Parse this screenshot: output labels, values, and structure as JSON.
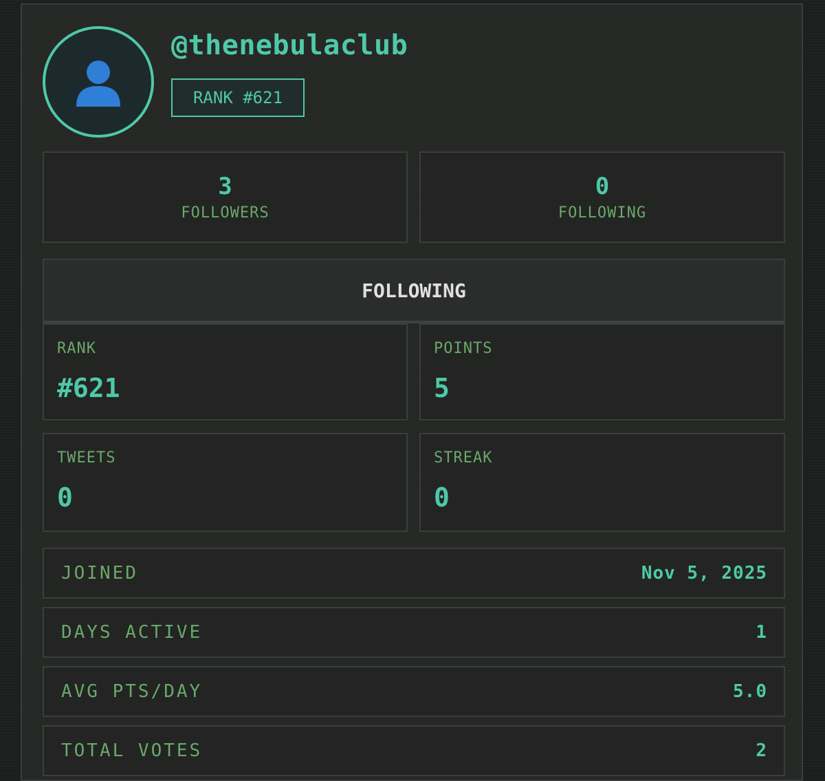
{
  "profile": {
    "username": "@thenebulaclub",
    "rank_badge": "RANK #621",
    "avatar_icon": "user-silhouette-icon"
  },
  "social": {
    "followers_count": "3",
    "followers_label": "FOLLOWERS",
    "following_count": "0",
    "following_label": "FOLLOWING"
  },
  "section": {
    "title": "FOLLOWING"
  },
  "stats": {
    "rank_label": "RANK",
    "rank_value": "#621",
    "points_label": "POINTS",
    "points_value": "5",
    "tweets_label": "TWEETS",
    "tweets_value": "0",
    "streak_label": "STREAK",
    "streak_value": "0"
  },
  "details": [
    {
      "label": "JOINED",
      "value": "Nov 5, 2025"
    },
    {
      "label": "DAYS ACTIVE",
      "value": "1"
    },
    {
      "label": "AVG PTS/DAY",
      "value": "5.0"
    },
    {
      "label": "TOTAL VOTES",
      "value": "2"
    }
  ],
  "colors": {
    "accent": "#4ec9a8",
    "label_green": "#6aa86a",
    "background": "#1e201f"
  }
}
